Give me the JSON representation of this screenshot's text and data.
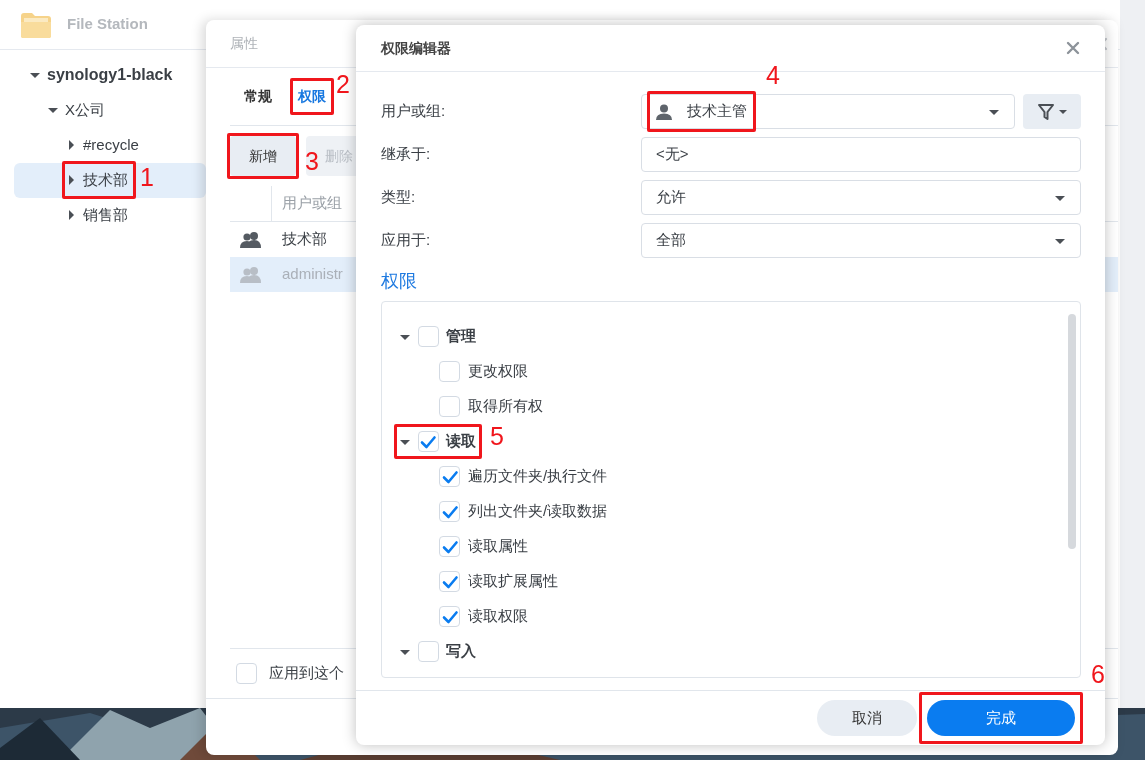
{
  "file_station": {
    "title": "File Station",
    "tree": [
      {
        "label": "synology1-black",
        "expanded": true,
        "selected": false,
        "children": [
          {
            "label": "X公司",
            "expanded": true,
            "selected": false,
            "children": [
              {
                "label": "#recycle",
                "expanded": false,
                "selected": false
              },
              {
                "label": "技术部",
                "expanded": false,
                "selected": true,
                "callout": "1"
              },
              {
                "label": "销售部",
                "expanded": false,
                "selected": false
              }
            ]
          }
        ]
      }
    ]
  },
  "properties": {
    "title": "属性",
    "tabs": [
      {
        "label": "常规",
        "selected": false
      },
      {
        "label": "权限",
        "selected": true,
        "callout": "2"
      }
    ],
    "toolbar": [
      {
        "label": "新增",
        "disabled": false,
        "callout": "3"
      },
      {
        "label": "删除",
        "disabled": true
      }
    ],
    "table": {
      "columns": [
        "用户或组"
      ],
      "rows": [
        {
          "cells": [
            "技术部"
          ],
          "selected": false,
          "disabled": false
        },
        {
          "cells": [
            "administr"
          ],
          "selected": true,
          "disabled": true
        }
      ]
    },
    "apply_option": {
      "label": "应用到这个",
      "checked": false
    }
  },
  "editor": {
    "title": "权限编辑器",
    "fields": [
      {
        "label": "用户或组:",
        "kind": "user-select",
        "value": "技术主管",
        "callout": "4"
      },
      {
        "label": "继承于:",
        "kind": "text",
        "value": "<无>"
      },
      {
        "label": "类型:",
        "kind": "select",
        "value": "允许"
      },
      {
        "label": "应用于:",
        "kind": "select",
        "value": "全部"
      }
    ],
    "permissions_heading": "权限",
    "permissions": [
      {
        "label": "管理",
        "checked": false,
        "expanded": true,
        "children": [
          {
            "label": "更改权限",
            "checked": false
          },
          {
            "label": "取得所有权",
            "checked": false
          }
        ]
      },
      {
        "label": "读取",
        "checked": true,
        "expanded": true,
        "callout": "5",
        "children": [
          {
            "label": "遍历文件夹/执行文件",
            "checked": true
          },
          {
            "label": "列出文件夹/读取数据",
            "checked": true
          },
          {
            "label": "读取属性",
            "checked": true
          },
          {
            "label": "读取扩展属性",
            "checked": true
          },
          {
            "label": "读取权限",
            "checked": true
          }
        ]
      },
      {
        "label": "写入",
        "checked": false,
        "expanded": true
      }
    ],
    "buttons": [
      {
        "label": "取消",
        "kind": "secondary"
      },
      {
        "label": "完成",
        "kind": "primary",
        "callout": "6"
      }
    ]
  }
}
